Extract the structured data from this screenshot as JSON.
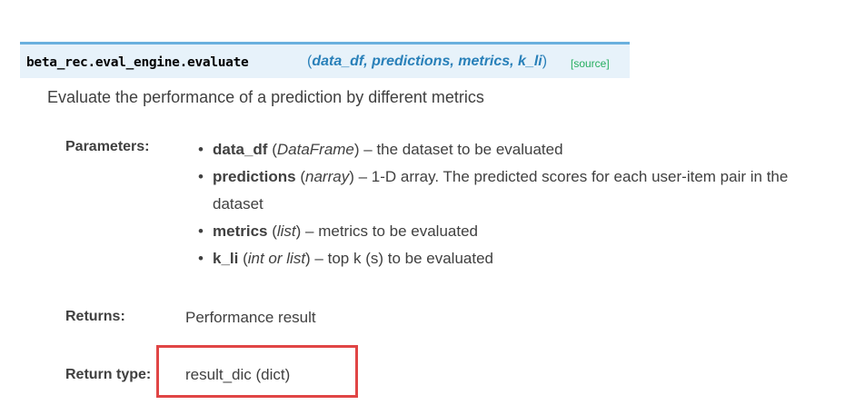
{
  "signature": {
    "name": "beta_rec.eval_engine.evaluate",
    "open_paren": "(",
    "params": "data_df, predictions, metrics, k_li",
    "close_paren": ")",
    "source_link": "[source]"
  },
  "description": "Evaluate the performance of a prediction by different metrics",
  "parameters": {
    "label": "Parameters:",
    "items": [
      {
        "name": "data_df",
        "type": "DataFrame",
        "desc": "the dataset to be evaluated"
      },
      {
        "name": "predictions",
        "type": "narray",
        "desc": "1-D array. The predicted scores for each user-item pair in the dataset"
      },
      {
        "name": "metrics",
        "type": "list",
        "desc": "metrics to be evaluated"
      },
      {
        "name": "k_li",
        "type": "int or list",
        "desc": "top k (s) to be evaluated"
      }
    ]
  },
  "returns": {
    "label": "Returns:",
    "value": "Performance result"
  },
  "return_type": {
    "label": "Return type:",
    "value": "result_dic (dict)"
  },
  "colors": {
    "signature_bg": "#e7f2fa",
    "signature_border": "#6ab0de",
    "param_text": "#2980b9",
    "source_link": "#27ae60",
    "highlight_border": "#e04545"
  }
}
